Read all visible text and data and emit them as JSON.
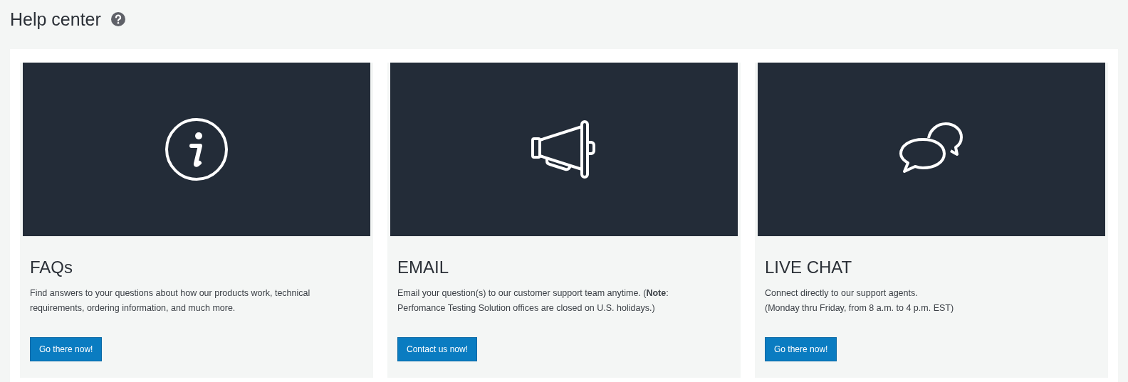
{
  "page": {
    "title": "Help center"
  },
  "cards": [
    {
      "kind": "faq",
      "title": "FAQs",
      "text": "Find answers to your questions about how our products work, technical requirements, ordering information, and much more.",
      "button": "Go there now!"
    },
    {
      "kind": "email",
      "title": "EMAIL",
      "text": "Email your question(s) to our customer support team anytime. (**Note**: Perfomance Testing Solution offices are closed on U.S. holidays.)",
      "button": "Contact us now!"
    },
    {
      "kind": "chat",
      "title": "LIVE CHAT",
      "text": "Connect directly to our support agents.\n(Monday thru Friday, from 8 a.m. to 4 p.m. EST)",
      "button": "Go there now!"
    }
  ]
}
